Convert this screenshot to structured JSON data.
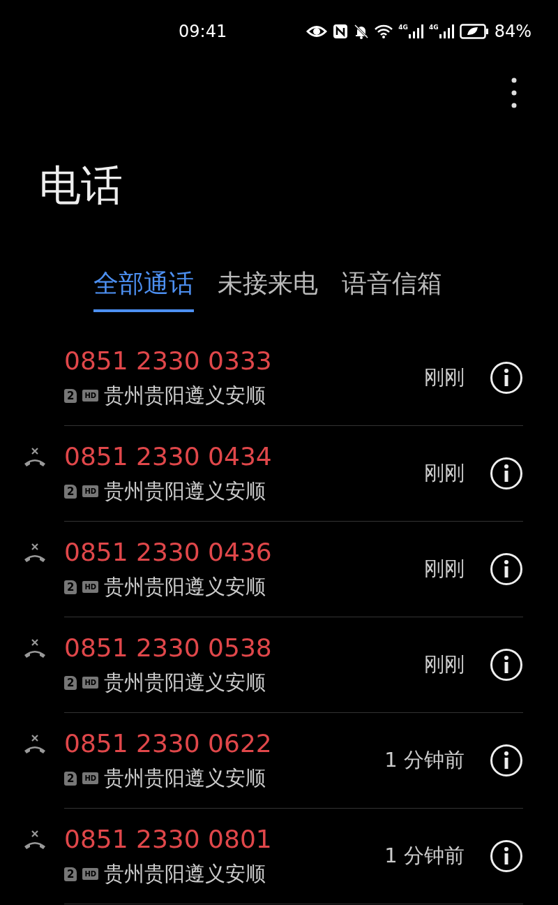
{
  "status_bar": {
    "time": "09:41",
    "networks": [
      "4G",
      "4G"
    ],
    "battery": "84%"
  },
  "title": "电话",
  "tabs": [
    {
      "label": "全部通话",
      "selected": true
    },
    {
      "label": "未接来电",
      "selected": false
    },
    {
      "label": "语音信箱",
      "selected": false
    }
  ],
  "calls": [
    {
      "number": "0851 2330 0333",
      "sim": "2",
      "hd": "HD",
      "location": "贵州贵阳遵义安顺",
      "time": "刚刚",
      "missed": false
    },
    {
      "number": "0851 2330 0434",
      "sim": "2",
      "hd": "HD",
      "location": "贵州贵阳遵义安顺",
      "time": "刚刚",
      "missed": true
    },
    {
      "number": "0851 2330 0436",
      "sim": "2",
      "hd": "HD",
      "location": "贵州贵阳遵义安顺",
      "time": "刚刚",
      "missed": true
    },
    {
      "number": "0851 2330 0538",
      "sim": "2",
      "hd": "HD",
      "location": "贵州贵阳遵义安顺",
      "time": "刚刚",
      "missed": true
    },
    {
      "number": "0851 2330 0622",
      "sim": "2",
      "hd": "HD",
      "location": "贵州贵阳遵义安顺",
      "time": "1 分钟前",
      "missed": true
    },
    {
      "number": "0851 2330 0801",
      "sim": "2",
      "hd": "HD",
      "location": "贵州贵阳遵义安顺",
      "time": "1 分钟前",
      "missed": true
    }
  ]
}
